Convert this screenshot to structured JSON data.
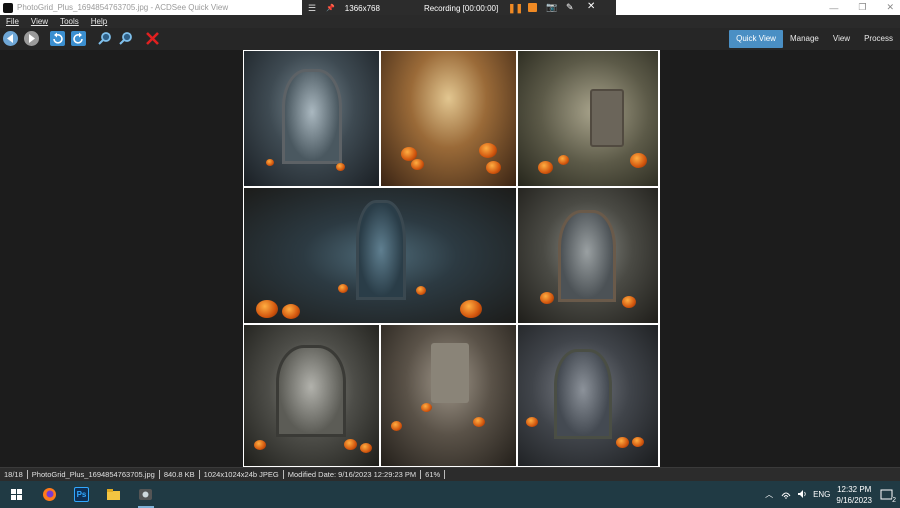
{
  "window": {
    "title": "PhotoGrid_Plus_1694854763705.jpg - ACDSee Quick View",
    "minimize": "—",
    "restore": "❐",
    "close": "✕"
  },
  "recording": {
    "menu_icon": "☰",
    "pin_icon": "📌",
    "resolution": "1366x768",
    "status": "Recording [00:00:00]",
    "pause_icon": "❚❚",
    "camera_icon": "📷",
    "pen_icon": "✎",
    "close_icon": "✕"
  },
  "menu": [
    "File",
    "View",
    "Tools",
    "Help"
  ],
  "toolbar": {
    "icons": [
      "back-icon",
      "forward-icon",
      "rotate-left-icon",
      "rotate-right-icon",
      "zoom-in-icon",
      "zoom-out-icon",
      "delete-icon"
    ],
    "tabs": [
      "Quick View",
      "Manage",
      "View",
      "Process"
    ],
    "active_tab": "Quick View"
  },
  "status": {
    "index": "18/18",
    "filename": "PhotoGrid_Plus_1694854763705.jpg",
    "size": "840.8 KB",
    "dimensions": "1024x1024x24b JPEG",
    "modified": "Modified Date: 9/16/2023 12:29:23 PM",
    "zoom": "61%"
  },
  "taskbar": {
    "apps": [
      "windows-start-icon",
      "firefox-icon",
      "photoshop-icon",
      "file-explorer-icon",
      "acdsee-icon"
    ],
    "photoshop_label": "Ps",
    "tray": {
      "chevron": "︿",
      "language": "ENG",
      "time": "12:32 PM",
      "date": "9/16/2023",
      "notifications": "2"
    }
  },
  "colors": {
    "accent": "#4a8fc4",
    "record": "#f08a24",
    "taskbar": "#203a44"
  }
}
